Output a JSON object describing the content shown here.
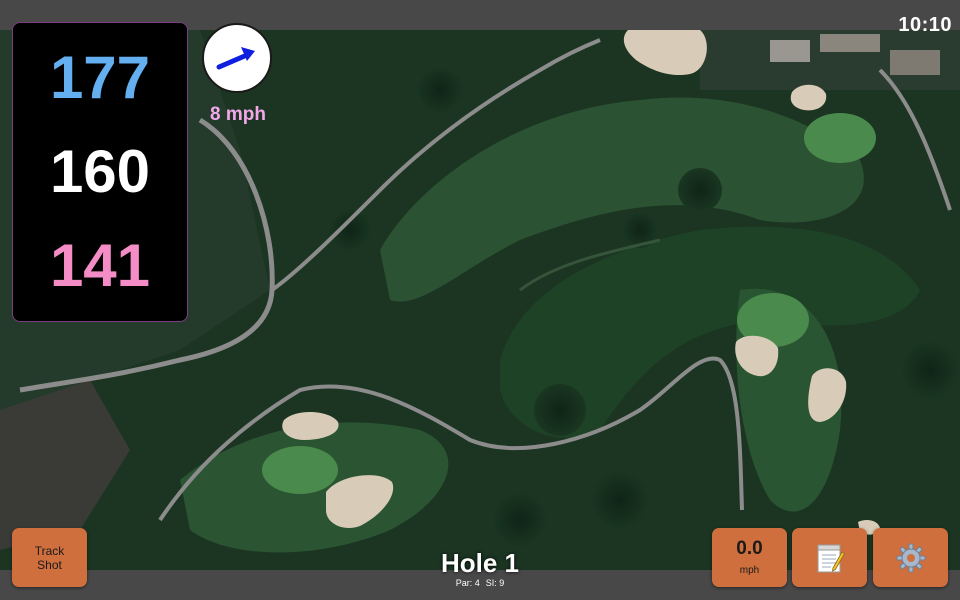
{
  "status": {
    "time": "10:10"
  },
  "distances": {
    "back": "177",
    "center": "160",
    "front": "141"
  },
  "wind": {
    "speed": "8 mph",
    "icon": "wind-arrow-icon"
  },
  "hole": {
    "title": "Hole 1",
    "par": "Par: 4",
    "si": "SI: 9"
  },
  "buttons": {
    "track_shot": "Track Shot",
    "speed_value": "0.0",
    "speed_unit": "mph",
    "notes_icon": "notepad-icon",
    "settings_icon": "gear-icon"
  },
  "map": {
    "type": "satellite-golf-course"
  },
  "colors": {
    "accent_button": "#d06f3e",
    "back_distance": "#63aff0",
    "center_distance": "#ffffff",
    "front_distance": "#f48cc6",
    "wind_text": "#f4a8ec"
  }
}
